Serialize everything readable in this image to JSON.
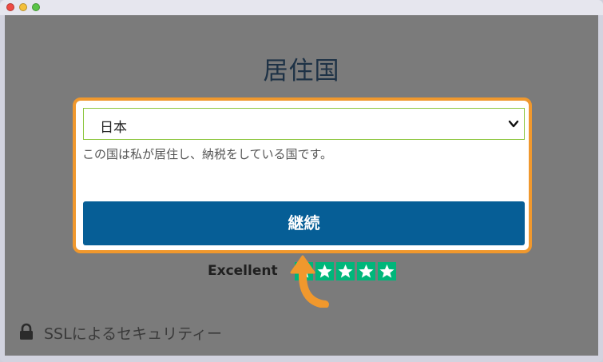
{
  "page": {
    "title": "居住国"
  },
  "country_select": {
    "value": "日本",
    "helper": "この国は私が居住し、納税をしている国です。"
  },
  "continue_button": {
    "label": "継続"
  },
  "rating": {
    "label": "Excellent",
    "stars": 5
  },
  "security": {
    "label": "SSLによるセキュリティー"
  },
  "colors": {
    "button": "#065e96",
    "highlight": "#f0982d",
    "stars": "#00b67a",
    "overlay": "#7b7b7b"
  }
}
